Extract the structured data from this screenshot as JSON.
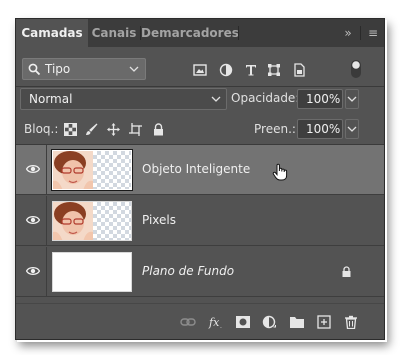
{
  "tabs": [
    {
      "label": "Camadas",
      "active": true
    },
    {
      "label": "Canais",
      "active": false
    },
    {
      "label": "Demarcadores",
      "active": false
    }
  ],
  "tabbar": {
    "collapse_glyph": "»",
    "menu_glyph": "≡"
  },
  "filter": {
    "kind_label": "Tipo",
    "icons": [
      "image-filter-icon",
      "adjustment-filter-icon",
      "type-filter-icon",
      "shape-filter-icon",
      "smart-object-filter-icon",
      "filter-toggle-icon"
    ]
  },
  "blend": {
    "mode": "Normal",
    "opacity_label": "Opacidade:",
    "opacity_value": "100%"
  },
  "lock": {
    "label": "Bloq.:",
    "icons": [
      "lock-transparent-icon",
      "lock-paint-icon",
      "lock-position-icon",
      "lock-artboard-icon",
      "lock-all-icon"
    ],
    "fill_label": "Preen.:",
    "fill_value": "100%"
  },
  "layers": [
    {
      "name": "Objeto Inteligente",
      "visible": true,
      "selected": true,
      "locked": false,
      "thumbnail": "portrait-transparent"
    },
    {
      "name": "Pixels",
      "visible": true,
      "selected": false,
      "locked": false,
      "thumbnail": "portrait-transparent"
    },
    {
      "name": "Plano de Fundo",
      "visible": true,
      "selected": false,
      "locked": true,
      "thumbnail": "white"
    }
  ],
  "footer_icons": [
    "link-layers-icon",
    "fx-icon",
    "add-mask-icon",
    "new-adjustment-icon",
    "new-group-icon",
    "new-layer-icon",
    "delete-icon"
  ],
  "colors": {
    "panel": "#535353",
    "selected_row": "#737373",
    "tabbar": "#3c3c3c"
  }
}
